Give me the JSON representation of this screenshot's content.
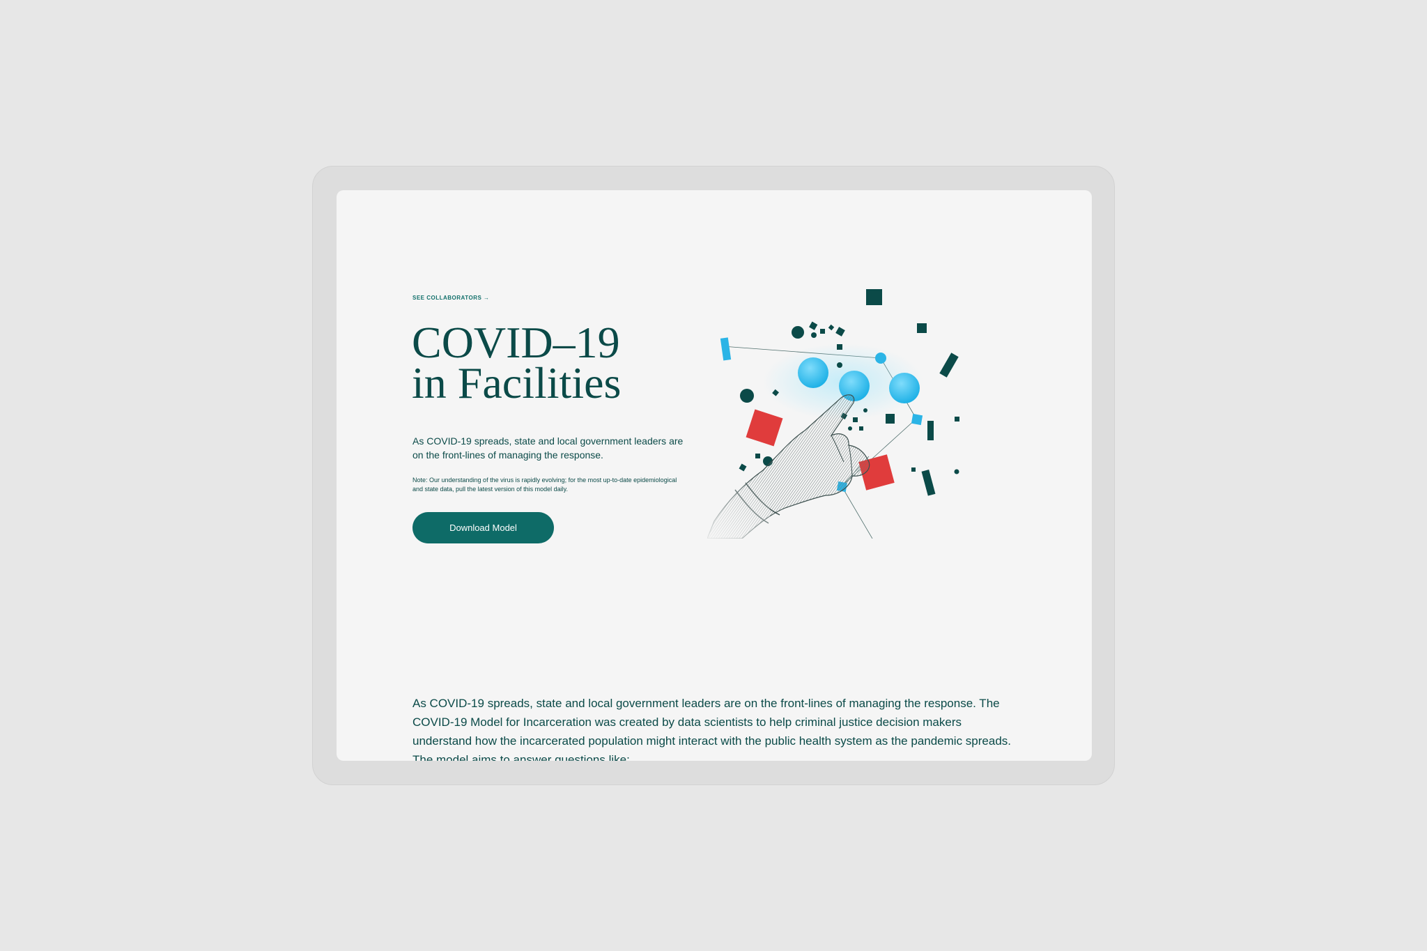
{
  "hero": {
    "collaborators_link": "SEE COLLABORATORS →",
    "title_line1": "COVID–19",
    "title_line2": "in Facilities",
    "lead": "As COVID-19 spreads, state and local government leaders are on the front-lines of managing the response.",
    "note": "Note: Our understanding of the virus is rapidly evolving; for the most up-to-date epidemiological and state data, pull the latest version of this model daily.",
    "download_label": "Download Model"
  },
  "body": {
    "paragraph": "As COVID-19 spreads, state and local government leaders are on the front-lines of managing the response. The COVID-19 Model for Incarceration was created by data scientists to help criminal justice decision makers understand how the incarcerated population might interact with the public health system as the pandemic spreads. The model aims to answer questions like:"
  },
  "illustration": {
    "icon": "hand-pointing-molecule-illustration",
    "colors": {
      "dark_teal": "#0b4a48",
      "cyan": "#22b4e6",
      "red": "#e03c3c"
    }
  },
  "colors": {
    "device_frame": "#dddddd",
    "screen_bg": "#f5f5f5",
    "text": "#0b4a48",
    "accent": "#0e6b67"
  }
}
